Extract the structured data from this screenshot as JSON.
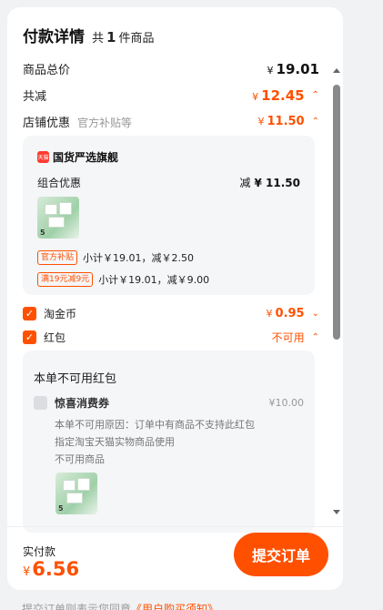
{
  "header": {
    "title": "付款详情",
    "count_prefix": "共",
    "count": "1",
    "count_suffix": "件商品"
  },
  "summary": {
    "goods_total_label": "商品总价",
    "goods_total_currency": "¥",
    "goods_total": "19.01",
    "discount_label": "共减",
    "discount_currency": "¥",
    "discount": "12.45",
    "shop_discount_label": "店铺优惠",
    "shop_discount_sub": "官方补贴等",
    "shop_discount_currency": "¥",
    "shop_discount": "11.50"
  },
  "shop_card": {
    "logo_text": "天猫",
    "shop_name": "国货严选旗舰",
    "combo_label": "组合优惠",
    "combo_prefix": "减",
    "combo_value": "¥ 11.50",
    "thumb_qty": "5",
    "tags": [
      {
        "tag": "官方补贴",
        "text": "小计￥19.01，减￥2.50"
      },
      {
        "tag": "满19元减9元",
        "text": "小计￥19.01，减￥9.00"
      }
    ]
  },
  "taojinbi": {
    "label": "淘金币",
    "currency": "¥",
    "value": "0.95"
  },
  "hongbao": {
    "label": "红包",
    "status": "不可用"
  },
  "unavailable_card": {
    "title": "本单不可用红包",
    "coupon_name": "惊喜消费券",
    "coupon_amount": "¥10.00",
    "reasons": [
      "本单不可用原因：订单中有商品不支持此红包",
      "指定淘宝天猫实物商品使用",
      "不可用商品"
    ],
    "thumb_qty": "5"
  },
  "footer": {
    "pay_label": "实付款",
    "pay_currency": "¥",
    "pay_amount": "6.56",
    "submit_label": "提交订单",
    "agreement_prefix": "提交订单则表示您同意",
    "agreement_link": "《用户购买须知》"
  },
  "colors": {
    "accent": "#ff5000",
    "card_bg": "#f5f6f8"
  }
}
